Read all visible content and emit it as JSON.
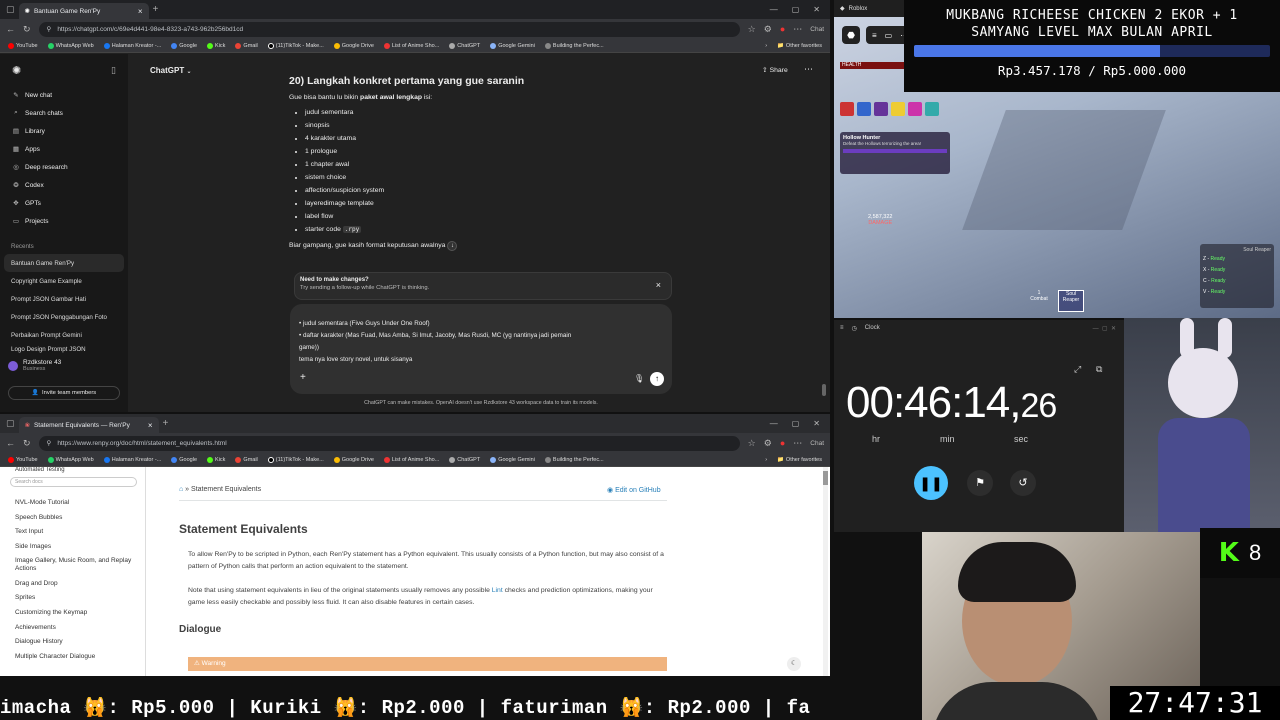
{
  "top_browser": {
    "tab_title": "Bantuan Game Ren'Py",
    "url": "https://chatgpt.com/c/69e4d441-98e4-8323-a743-962b256bd1cd",
    "bookmarks": [
      "YouTube",
      "WhatsApp Web",
      "Halaman Kreator -...",
      "Google",
      "Kick",
      "Gmail",
      "(11)TikTok - Make...",
      "Google Drive",
      "List of Anime Sho...",
      "ChatGPT",
      "Google Gemini",
      "Building the Perfec..."
    ],
    "other_favorites": "Other favorites",
    "side_label": "Chat"
  },
  "chatgpt": {
    "brand": "ChatGPT",
    "share": "Share",
    "nav": [
      "New chat",
      "Search chats",
      "Library",
      "Apps",
      "Deep research",
      "Codex",
      "GPTs",
      "Projects"
    ],
    "recents_label": "Recents",
    "recents": [
      "Bantuan Game Ren'Py",
      "Copyright Game Example",
      "Prompt JSON Gambar Hati",
      "Prompt JSON Penggabungan Foto",
      "Perbaikan Prompt Gemini",
      "Logo Design Prompt JSON"
    ],
    "account_name": "Rzdkstore 43",
    "account_plan": "Business",
    "invite": "Invite team members",
    "heading": "20) Langkah konkret pertama yang gue saranin",
    "intro_pre": "Gue bisa bantu lu bikin ",
    "intro_bold": "paket awal lengkap",
    "intro_post": " isi:",
    "list": [
      "judul sementara",
      "sinopsis",
      "4 karakter utama",
      "1 prologue",
      "1 chapter awal",
      "sistem choice",
      "affection/suspicion system",
      "layeredimage template",
      "label flow",
      "starter code"
    ],
    "starter_code_tag": ".rpy",
    "outro": "Biar gampang, gue kasih format keputusan awalnya",
    "popup_title": "Need to make changes?",
    "popup_sub": "Try sending a follow-up while ChatGPT is thinking.",
    "draft_lines": [
      "• judul sementara (Five Guys Under One Roof)",
      "• daftar karakter (Mas Fuad, Mas Amba, Si Imut, Jacoby, Mas Rusdi, MC (yg nantinya jadi pemain",
      "game))",
      "tema nya love story novel, untuk sisanya"
    ],
    "disclaimer": "ChatGPT can make mistakes. OpenAI doesn't use Rzdkstore 43 workspace data to train its models."
  },
  "bottom_browser": {
    "tab_title": "Statement Equivalents — Ren'Py",
    "url": "https://www.renpy.org/doc/html/statement_equivalents.html",
    "bookmarks": [
      "YouTube",
      "WhatsApp Web",
      "Halaman Kreator -...",
      "Google",
      "Kick",
      "Gmail",
      "(11)TikTok - Make...",
      "Google Drive",
      "List of Anime Sho...",
      "ChatGPT",
      "Google Gemini",
      "Building the Perfec..."
    ],
    "other_favorites": "Other favorites",
    "side_label": "Chat"
  },
  "renpy": {
    "sidebar_top": "Automated Testing",
    "search_placeholder": "Search docs",
    "sidebar": [
      "NVL-Mode Tutorial",
      "Speech Bubbles",
      "Text Input",
      "Side Images",
      "Image Gallery, Music Room, and Replay Actions",
      "Drag and Drop",
      "Sprites",
      "Customizing the Keymap",
      "Achievements",
      "Dialogue History",
      "Multiple Character Dialogue"
    ],
    "breadcrumb": "Statement Equivalents",
    "edit": "Edit on GitHub",
    "title": "Statement Equivalents",
    "p1": "To allow Ren'Py to be scripted in Python, each Ren'Py statement has a Python equivalent. This usually consists of a Python function, but may also consist of a pattern of Python calls that perform an action equivalent to the statement.",
    "p2_pre": "Note that using statement equivalents in lieu of the original statements usually removes any possible ",
    "p2_link": "Lint",
    "p2_post": " checks and prediction optimizations, making your game less easily checkable and possibly less fluid. It can also disable features in certain cases.",
    "h2": "Dialogue",
    "warning": "Warning"
  },
  "donation_goal": {
    "title_line1": "MUKBANG RICHEESE CHICKEN 2 EKOR + 1",
    "title_line2": "SAMYANG LEVEL MAX BULAN APRIL",
    "amount": "Rp3.457.178 / Rp5.000.000",
    "progress": 0.69
  },
  "game": {
    "window_title": "Roblox",
    "health_label": "HEALTH",
    "quest_title": "Hollow Hunter",
    "quest_desc": "Defeat the Hollows terrorizing the area!",
    "damage_value": "2,587,322",
    "damage_label": "DAMAGE",
    "combat": "Combat",
    "soul_reaper": "Soul Reaper",
    "slot_number": "1",
    "panel_title": "Soul Reaper",
    "skills": [
      {
        "key": "Z",
        "state": "Ready"
      },
      {
        "key": "X",
        "state": "Ready"
      },
      {
        "key": "C",
        "state": "Ready"
      },
      {
        "key": "V",
        "state": "Ready"
      }
    ]
  },
  "clock": {
    "window_title": "Clock",
    "main": "00:46:14,",
    "centi": "26",
    "hr": "hr",
    "min": "min",
    "sec": "sec"
  },
  "kick_badge": {
    "count": "8"
  },
  "bottom_timer": "27:47:31",
  "ticker": "imacha 🙀: Rp5.000 | Kuriki 🙀: Rp2.000 | faturiman 🙀: Rp2.000 | fa",
  "colors": {
    "chat_bg": "#212121",
    "sidebar_bg": "#181818",
    "accent_blue": "#3f6fd8",
    "kick_green": "#53fc18",
    "warning_orange": "#f0b37e"
  }
}
